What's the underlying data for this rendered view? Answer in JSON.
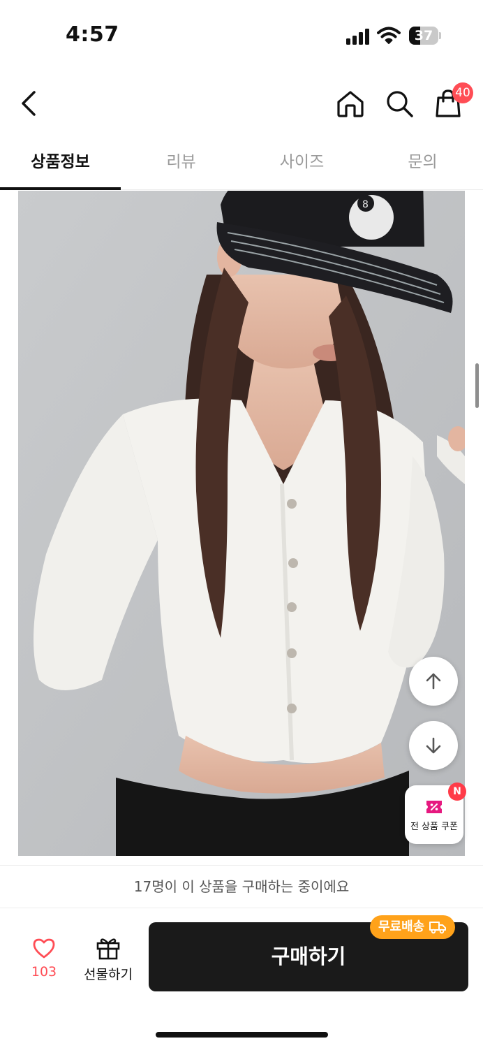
{
  "status_bar": {
    "time": "4:57",
    "battery": "37",
    "battery_level": 0.37
  },
  "nav": {
    "cart_count": "40"
  },
  "tabs": [
    {
      "label": "상품정보",
      "active": true
    },
    {
      "label": "리뷰",
      "active": false
    },
    {
      "label": "사이즈",
      "active": false
    },
    {
      "label": "문의",
      "active": false
    }
  ],
  "coupon": {
    "label": "전 상품 쿠폰",
    "badge": "N"
  },
  "live_notice": "17명이 이 상품을 구매하는 중이에요",
  "action_bar": {
    "like_count": "103",
    "gift_label": "선물하기",
    "buy_label": "구매하기",
    "free_shipping": "무료배송"
  },
  "colors": {
    "accent_red": "#ff4d55",
    "buy_button": "#1a1a1a",
    "shipping_badge": "#ffa21a",
    "coupon_pink": "#e6187f"
  }
}
